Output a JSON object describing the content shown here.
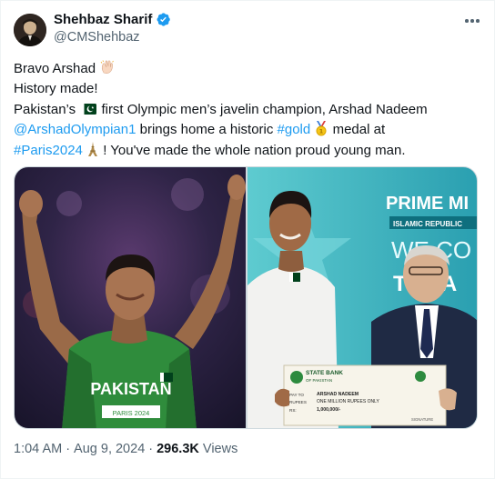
{
  "author": {
    "name": "Shehbaz Sharif",
    "handle": "@CMShehbaz",
    "verified_icon": "verified-badge-icon",
    "accent_color": "#1d9bf0"
  },
  "more_icon": "more-horizontal-icon",
  "tweet": {
    "line1": "Bravo Arshad",
    "line2": "History made!",
    "line3_a": "Pakistan’s",
    "line3_b": "first Olympic men’s javelin champion, Arshad Nadeem",
    "mention": "@ArshadOlympian1",
    "line4_b": "brings home a historic",
    "hashtag_gold": "#gold",
    "line4_d": "medal at",
    "hashtag_paris": "#Paris2024",
    "line5_b": "! You've made the whole nation proud young man.",
    "emojis": [
      "clapping-hands-emoji",
      "pakistan-flag-emoji",
      "gold-medal-emoji",
      "eiffel-tower-emoji"
    ]
  },
  "media": {
    "left": {
      "jersey_text": "PAKISTAN",
      "bib_text": "PARIS 2024"
    },
    "right": {
      "banner_line1": "PRIME MI",
      "banner_line2": "ISLAMIC REPUBLIC",
      "banner_line3": "WE CO",
      "banner_line4": "TEA A",
      "cheque_bank": "STATE BANK",
      "cheque_bank_sub": "OF PAKISTAN",
      "cheque_payee_label": "PAY TO",
      "cheque_payee": "ARSHAD NADEEM",
      "cheque_rupees_label": "RUPEES",
      "cheque_amount_words": "ONE MILLION RUPEES ONLY",
      "cheque_rs_label": "RS:",
      "cheque_amount": "1,000,000/-",
      "cheque_signature": "SIGNATURE"
    }
  },
  "meta": {
    "time": "1:04 AM",
    "separator": "·",
    "date": "Aug 9, 2024",
    "views_count": "296.3K",
    "views_label": "Views"
  }
}
